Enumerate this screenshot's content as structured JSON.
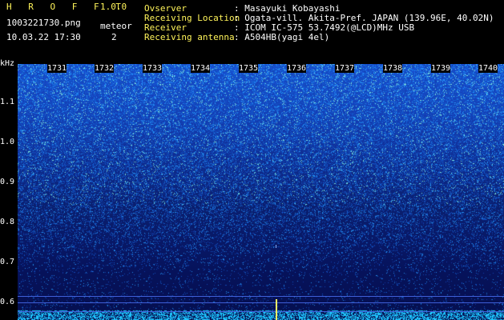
{
  "header": {
    "app_name": "H R O F F T",
    "version": "1.0.0",
    "filename": "1003221730.png",
    "datetime": "10.03.22 17:30",
    "meteor_label": "meteor",
    "meteor_count": "2",
    "fields": [
      {
        "label": "Ovserver",
        "value": ": Masayuki Kobayashi"
      },
      {
        "label": "Receiving Location",
        "value": ": Ogata-vill. Akita-Pref. JAPAN (139.96E, 40.02N)"
      },
      {
        "label": "Receiver",
        "value": ": ICOM IC-575 53.7492(@LCD)MHz USB"
      },
      {
        "label": "Receiving antenna",
        "value": ": A504HB(yagi 4el)"
      }
    ]
  },
  "axis": {
    "unit": "kHz",
    "y_labels": [
      "1.1",
      "1.0",
      "0.9",
      "0.8",
      "0.7",
      "0.6"
    ],
    "time_labels": [
      "1731",
      "1732",
      "1733",
      "1734",
      "1735",
      "1736",
      "1737",
      "1738",
      "1739",
      "1740"
    ]
  },
  "colors": {
    "accent_green": "#27f227",
    "accent_yellow": "#fff45a",
    "spectrum_top": "#1a4fd6",
    "spectrum_bottom": "#050f4f"
  }
}
